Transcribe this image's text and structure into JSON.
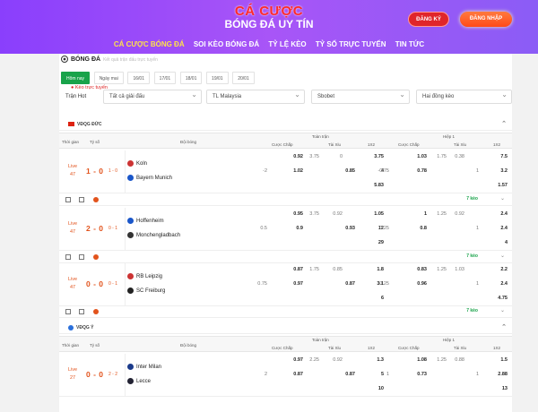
{
  "logo": {
    "line1": "CÁ CƯỢC",
    "line2": "BÓNG ĐÁ UY TÍN"
  },
  "auth": {
    "register": "ĐĂNG KÝ",
    "login": "ĐĂNG NHẬP"
  },
  "nav": [
    "CÁ CƯỢC BÓNG ĐÁ",
    "SOI KÈO BÓNG ĐÁ",
    "TỶ LỆ KÈO",
    "TỶ SỐ TRỰC TUYẾN",
    "TIN TỨC"
  ],
  "section": {
    "title": "BÓNG ĐÁ",
    "subtitle": "Kết quả trận đấu trực tuyến"
  },
  "tabs": [
    "Kèo trực tuyến",
    "Hôm nay",
    "Ngày mai",
    "16/01",
    "17/01",
    "18/01",
    "19/01",
    "20/01"
  ],
  "filters": {
    "label": "Trận Hot",
    "league": "Tất cả giải đấu",
    "region": "TL Malaysia",
    "bookmaker": "Sbobet",
    "market": "Hai đồng kèo"
  },
  "table_head": {
    "time": "Thời gian",
    "score": "Tỷ số",
    "teams": "Đội bóng",
    "full": "Toàn trận",
    "half": "Hiệp 1",
    "handicap": "Cược Chấp",
    "ou": "Tài Xỉu",
    "x12": "1X2"
  },
  "leagues": [
    {
      "name": "VĐQG ĐỨC"
    },
    {
      "name": "VĐQG Ý"
    }
  ],
  "matches": [
    {
      "status": "Live",
      "minute": "47",
      "score": "1 - 0",
      "ht": "1 - 0",
      "home": "Koln",
      "away": "Bayern Munich",
      "full": {
        "h1": "0.92",
        "h2": "1.02",
        "hl": "-2",
        "ou_l": "3.75",
        "ou1": "0",
        "ou2": "0.85",
        "x1": "3.75",
        "x2": "4",
        "x3": "5.83"
      },
      "half": {
        "h1": "1.03",
        "h2": "0.78",
        "hl": "-0.75",
        "ou_l": "1.75",
        "ou1": "0.38",
        "ou2": "1",
        "x1": "7.5",
        "x2": "3.2",
        "x3": "1.57"
      },
      "more": "7 kèo"
    },
    {
      "status": "Live",
      "minute": "47",
      "score": "2 - 0",
      "ht": "0 - 1",
      "home": "Hoffenheim",
      "away": "Monchengladbach",
      "full": {
        "h1": "0.95",
        "h2": "0.9",
        "hl": "0.5",
        "ou_l": "3.75",
        "ou1": "0.92",
        "ou2": "0.93",
        "x1": "1.05",
        "x2": "12",
        "x3": "29"
      },
      "half": {
        "h1": "1",
        "h2": "0.8",
        "hl": "0.25",
        "ou_l": "1.25",
        "ou1": "0.92",
        "ou2": "1",
        "x1": "2.4",
        "x2": "2.4",
        "x3": "4"
      },
      "more": "7 kèo"
    },
    {
      "status": "Live",
      "minute": "47",
      "score": "0 - 0",
      "ht": "0 - 1",
      "home": "RB Leipzig",
      "away": "SC Freiburg",
      "full": {
        "h1": "0.87",
        "h2": "0.97",
        "hl": "0.75",
        "ou_l": "1.75",
        "ou1": "0.85",
        "ou2": "0.87",
        "x1": "1.8",
        "x2": "3.1",
        "x3": "6"
      },
      "half": {
        "h1": "0.83",
        "h2": "0.96",
        "hl": "0.25",
        "ou_l": "1.25",
        "ou1": "1.03",
        "ou2": "1",
        "x1": "2.2",
        "x2": "2.4",
        "x3": "4.75"
      },
      "more": "7 kèo"
    },
    {
      "status": "Live",
      "minute": "27",
      "score": "0 - 0",
      "ht": "2 - 2",
      "home": "Inter Milan",
      "away": "Lecce",
      "full": {
        "h1": "0.97",
        "h2": "0.87",
        "hl": "2",
        "ou_l": "2.25",
        "ou1": "0.92",
        "ou2": "0.87",
        "x1": "1.3",
        "x2": "5",
        "x3": "10"
      },
      "half": {
        "h1": "1.08",
        "h2": "0.73",
        "hl": "1",
        "ou_l": "1.25",
        "ou1": "0.88",
        "ou2": "1",
        "x1": "1.5",
        "x2": "2.88",
        "x3": "13"
      },
      "more": ""
    }
  ]
}
